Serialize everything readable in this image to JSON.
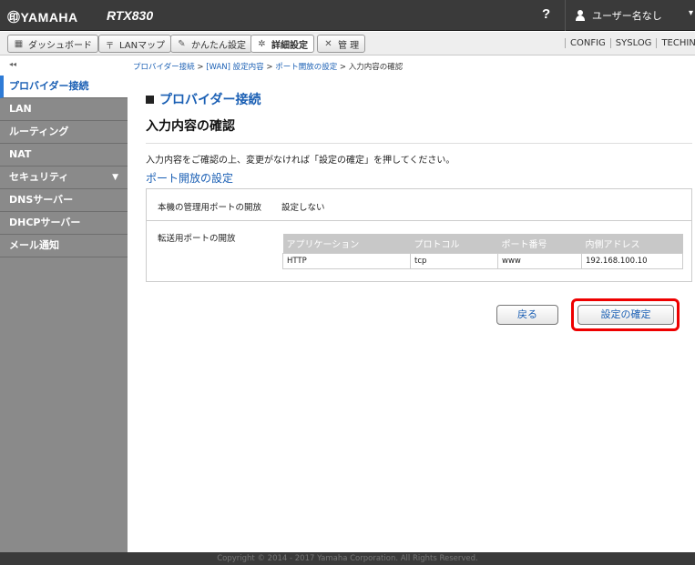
{
  "header": {
    "brand": "㊞YAMAHA",
    "model": "RTX830",
    "help": "?",
    "user_label": "ユーザー名なし",
    "caret": "▾"
  },
  "nav": {
    "tabs": [
      {
        "label": "ダッシュボード",
        "icon": "dashboard-icon"
      },
      {
        "label": "LANマップ",
        "icon": "lan-map-icon"
      },
      {
        "label": "かんたん設定",
        "icon": "easy-setup-icon"
      },
      {
        "label": "詳細設定",
        "icon": "gear-icon"
      },
      {
        "label": "管 理",
        "icon": "wrench-icon"
      }
    ],
    "links": [
      "CONFIG",
      "SYSLOG",
      "TECHINFO"
    ]
  },
  "collapse": "◂◂",
  "breadcrumb": {
    "items": [
      "プロバイダー接続",
      "[WAN] 設定内容",
      "ポート開放の設定"
    ],
    "current": "入力内容の確認",
    "separator": ">"
  },
  "sidebar": {
    "items": [
      {
        "label": "プロバイダー接続"
      },
      {
        "label": "LAN"
      },
      {
        "label": "ルーティング"
      },
      {
        "label": "NAT"
      },
      {
        "label": "セキュリティ",
        "arrow": "▼"
      },
      {
        "label": "DNSサーバー"
      },
      {
        "label": "DHCPサーバー"
      },
      {
        "label": "メール通知"
      }
    ]
  },
  "main": {
    "section_title": "プロバイダー接続",
    "page_title": "入力内容の確認",
    "description": "入力内容をご確認の上、変更がなければ「設定の確定」を押してください。",
    "sub_title": "ポート開放の設定",
    "mgmt_label": "本機の管理用ポートの開放",
    "mgmt_value": "設定しない",
    "fwd_label": "転送用ポートの開放",
    "table": {
      "headers": [
        "アプリケーション",
        "プロトコル",
        "ポート番号",
        "内側アドレス"
      ],
      "rows": [
        [
          "HTTP",
          "tcp",
          "www",
          "192.168.100.10"
        ]
      ]
    },
    "back_button": "戻る",
    "confirm_button": "設定の確定"
  },
  "footer": "Copyright © 2014 - 2017 Yamaha Corporation. All Rights Reserved.",
  "colors": {
    "accent": "#1a5fb4",
    "sidebar": "#8a8a8a",
    "topbar": "#3a3a3a",
    "highlight": "#ee0000"
  }
}
